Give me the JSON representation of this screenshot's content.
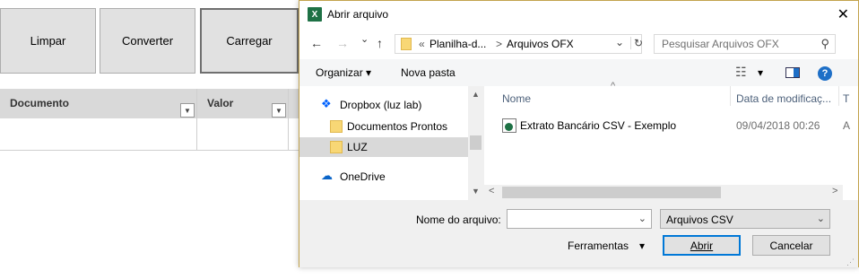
{
  "sheet": {
    "buttons": {
      "limpar": "Limpar",
      "converter": "Converter",
      "carregar": "Carregar"
    },
    "columns": {
      "documento": "Documento",
      "valor": "Valor"
    }
  },
  "dialog": {
    "title": "Abrir arquivo",
    "close_glyph": "✕",
    "nav": {
      "back": "←",
      "forward": "→",
      "recent": "⌄",
      "up": "↑",
      "refresh": "↻",
      "address": {
        "prefix": "«",
        "crumb1": "Planilha-d...",
        "sep": ">",
        "crumb2": "Arquivos OFX",
        "dropdown": "⌄"
      },
      "search_placeholder": "Pesquisar Arquivos OFX",
      "search_icon": "search-icon"
    },
    "toolbar": {
      "organizar": "Organizar",
      "nova_pasta": "Nova pasta",
      "caret": "▾",
      "view_glyph": "☷",
      "help": "?"
    },
    "nav_pane": {
      "items": [
        {
          "label": "Dropbox (luz lab)",
          "icon": "dropbox-icon"
        },
        {
          "label": "Documentos Prontos",
          "icon": "folder-icon"
        },
        {
          "label": "LUZ",
          "icon": "folder-icon",
          "selected": true
        },
        {
          "label": "OneDrive",
          "icon": "cloud-icon"
        }
      ],
      "up_arrow": "▲",
      "down_arrow": "▼"
    },
    "file_pane": {
      "col_name": "Nome",
      "col_date": "Data de modificaç...",
      "col_t": "T",
      "sort_caret": "^",
      "files": [
        {
          "name": "Extrato Bancário CSV - Exemplo",
          "date": "09/04/2018 00:26",
          "type_partial": "A"
        }
      ],
      "left_arrow": "<",
      "right_arrow": ">"
    },
    "bottom": {
      "filename_label": "Nome do arquivo:",
      "filename_value": "",
      "filetype_value": "Arquivos CSV",
      "ferramentas": "Ferramentas",
      "caret": "▾",
      "open_button": "Abrir",
      "cancel_button": "Cancelar"
    },
    "colors": {
      "accent": "#0078d7",
      "frame": "#c2a34d",
      "excel_green": "#1e7145"
    }
  }
}
